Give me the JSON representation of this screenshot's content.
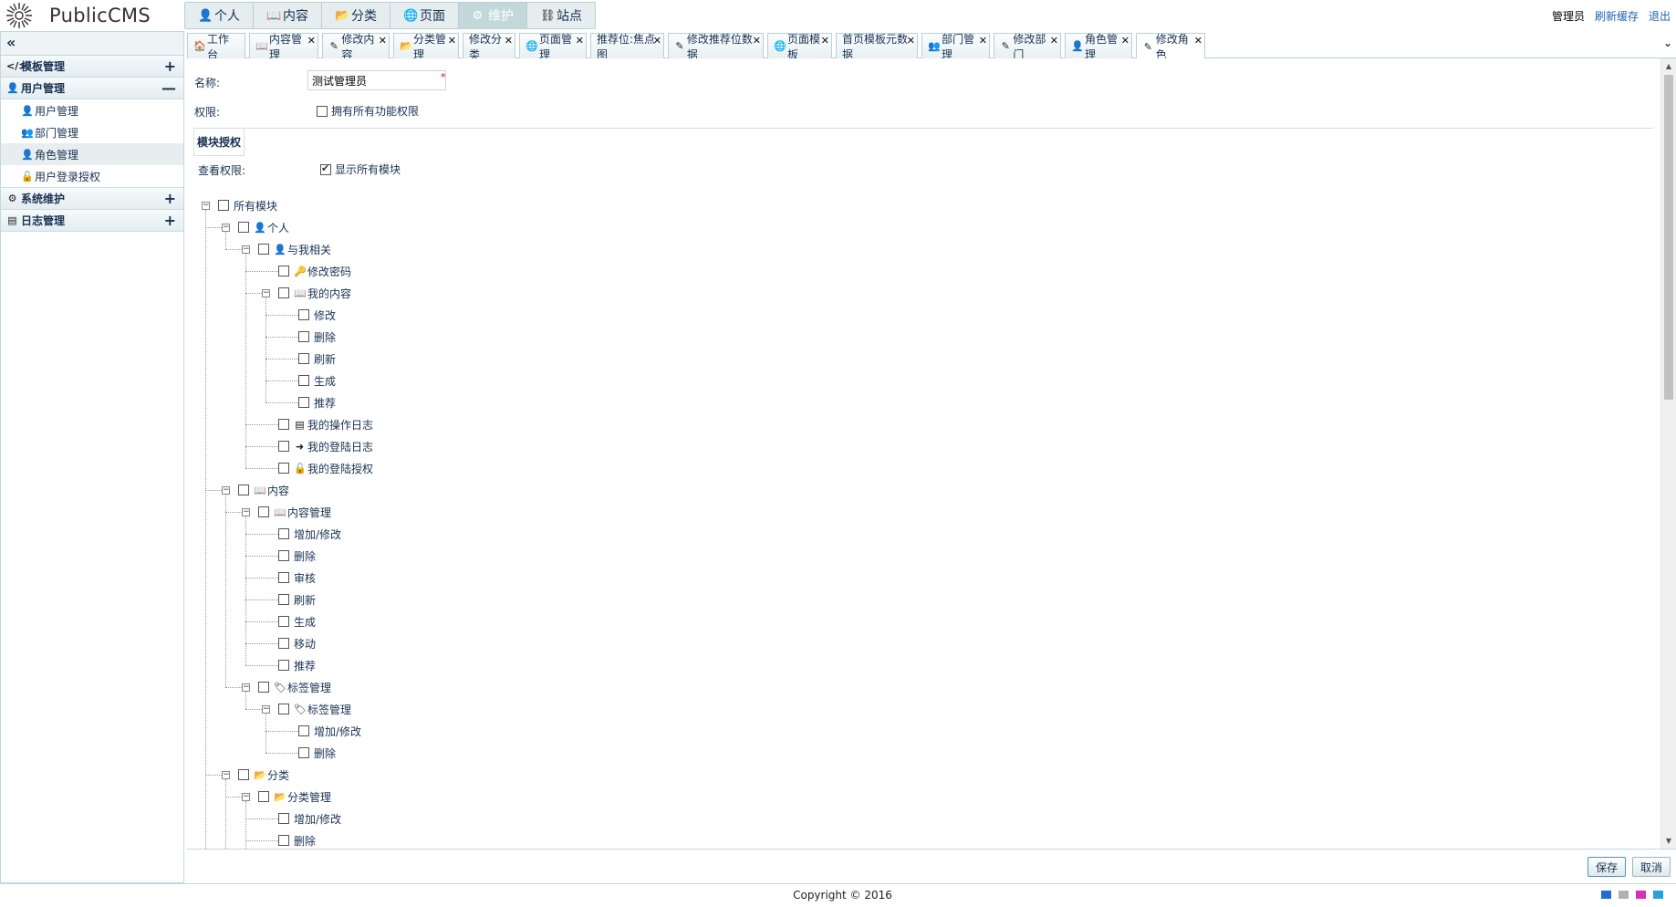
{
  "app": {
    "name": "PublicCMS"
  },
  "colors": {
    "accent": "#1e64b4",
    "nav_active": "#c2d9dc",
    "border": "#b8d0d6",
    "required": "#ee0000"
  },
  "topnav": [
    {
      "label": "个人",
      "icon": "user-icon",
      "glyph": "👤"
    },
    {
      "label": "内容",
      "icon": "book-icon",
      "glyph": "📖"
    },
    {
      "label": "分类",
      "icon": "folder-open-icon",
      "glyph": "📂"
    },
    {
      "label": "页面",
      "icon": "globe-icon",
      "glyph": "🌐"
    },
    {
      "label": "维护",
      "icon": "gear-icon",
      "glyph": "⚙",
      "active": true
    },
    {
      "label": "站点",
      "icon": "sitemap-icon",
      "glyph": "⛓"
    }
  ],
  "userbar": {
    "user": "管理员",
    "refresh_cache": "刷新缓存",
    "logout": "退出"
  },
  "sidebar": {
    "toggle": "«",
    "groups": [
      {
        "label": "模板管理",
        "icon": "code-icon",
        "glyph": "</>",
        "expanded": false
      },
      {
        "label": "用户管理",
        "icon": "user-icon",
        "glyph": "👤",
        "expanded": true,
        "items": [
          {
            "label": "用户管理",
            "icon": "user-icon",
            "glyph": "👤"
          },
          {
            "label": "部门管理",
            "icon": "users-icon",
            "glyph": "👥"
          },
          {
            "label": "角色管理",
            "icon": "user-secret-icon",
            "glyph": "👤",
            "active": true
          },
          {
            "label": "用户登录授权",
            "icon": "unlock-icon",
            "glyph": "🔓"
          }
        ]
      },
      {
        "label": "系统维护",
        "icon": "cogs-icon",
        "glyph": "⚙",
        "expanded": false
      },
      {
        "label": "日志管理",
        "icon": "list-alt-icon",
        "glyph": "▤",
        "expanded": false
      }
    ]
  },
  "tabs": [
    {
      "label": "工作台",
      "glyph": "🏠",
      "icon": "home-icon"
    },
    {
      "label": "内容管理",
      "glyph": "📖",
      "icon": "book-icon"
    },
    {
      "label": "修改内容",
      "glyph": "✎",
      "icon": "edit-icon"
    },
    {
      "label": "分类管理",
      "glyph": "📂",
      "icon": "folder-open-icon"
    },
    {
      "label": "修改分类",
      "glyph": "",
      "icon": ""
    },
    {
      "label": "页面管理",
      "glyph": "🌐",
      "icon": "globe-icon"
    },
    {
      "label": "推荐位:焦点图",
      "glyph": "",
      "icon": ""
    },
    {
      "label": "修改推荐位数据",
      "glyph": "✎",
      "icon": "edit-icon"
    },
    {
      "label": "页面模板",
      "glyph": "🌐",
      "icon": "globe-icon"
    },
    {
      "label": "首页模板元数据",
      "glyph": "",
      "icon": ""
    },
    {
      "label": "部门管理",
      "glyph": "👥",
      "icon": "users-icon"
    },
    {
      "label": "修改部门",
      "glyph": "✎",
      "icon": "edit-icon"
    },
    {
      "label": "角色管理",
      "glyph": "👤",
      "icon": "user-secret-icon"
    },
    {
      "label": "修改角色",
      "glyph": "✎",
      "icon": "edit-icon",
      "active": true
    }
  ],
  "form": {
    "name_label": "名称:",
    "name_value": "测试管理员",
    "required_mark": "*",
    "perm_label": "权限:",
    "all_perm_label": "拥有所有功能权限",
    "all_perm_checked": false,
    "module_legend": "模块授权",
    "view_label": "查看权限:",
    "show_all_label": "显示所有模块",
    "show_all_checked": true
  },
  "tree": [
    {
      "label": "所有模块",
      "level": 0,
      "toggle": true,
      "glyph": "",
      "icon": ""
    },
    {
      "label": "个人",
      "level": 1,
      "toggle": true,
      "glyph": "👤",
      "icon": "user-icon"
    },
    {
      "label": "与我相关",
      "level": 2,
      "toggle": true,
      "glyph": "👤",
      "icon": "user-icon"
    },
    {
      "label": "修改密码",
      "level": 3,
      "toggle": false,
      "glyph": "🔑",
      "icon": "key-icon"
    },
    {
      "label": "我的内容",
      "level": 3,
      "toggle": true,
      "glyph": "📖",
      "icon": "book-icon"
    },
    {
      "label": "修改",
      "level": 4,
      "toggle": false,
      "glyph": "",
      "icon": ""
    },
    {
      "label": "删除",
      "level": 4,
      "toggle": false,
      "glyph": "",
      "icon": ""
    },
    {
      "label": "刷新",
      "level": 4,
      "toggle": false,
      "glyph": "",
      "icon": ""
    },
    {
      "label": "生成",
      "level": 4,
      "toggle": false,
      "glyph": "",
      "icon": ""
    },
    {
      "label": "推荐",
      "level": 4,
      "toggle": false,
      "glyph": "",
      "icon": ""
    },
    {
      "label": "我的操作日志",
      "level": 3,
      "toggle": false,
      "glyph": "▤",
      "icon": "list-alt-icon"
    },
    {
      "label": "我的登陆日志",
      "level": 3,
      "toggle": false,
      "glyph": "➜",
      "icon": "sign-in-icon"
    },
    {
      "label": "我的登陆授权",
      "level": 3,
      "toggle": false,
      "glyph": "🔓",
      "icon": "unlock-icon"
    },
    {
      "label": "内容",
      "level": 1,
      "toggle": true,
      "glyph": "📖",
      "icon": "book-icon"
    },
    {
      "label": "内容管理",
      "level": 2,
      "toggle": true,
      "glyph": "📖",
      "icon": "book-icon"
    },
    {
      "label": "增加/修改",
      "level": 3,
      "toggle": false,
      "glyph": "",
      "icon": ""
    },
    {
      "label": "删除",
      "level": 3,
      "toggle": false,
      "glyph": "",
      "icon": ""
    },
    {
      "label": "审核",
      "level": 3,
      "toggle": false,
      "glyph": "",
      "icon": ""
    },
    {
      "label": "刷新",
      "level": 3,
      "toggle": false,
      "glyph": "",
      "icon": ""
    },
    {
      "label": "生成",
      "level": 3,
      "toggle": false,
      "glyph": "",
      "icon": ""
    },
    {
      "label": "移动",
      "level": 3,
      "toggle": false,
      "glyph": "",
      "icon": ""
    },
    {
      "label": "推荐",
      "level": 3,
      "toggle": false,
      "glyph": "",
      "icon": ""
    },
    {
      "label": "标签管理",
      "level": 2,
      "toggle": true,
      "glyph": "🏷",
      "icon": "tags-icon"
    },
    {
      "label": "标签管理",
      "level": 3,
      "toggle": true,
      "glyph": "🏷",
      "icon": "tag-icon"
    },
    {
      "label": "增加/修改",
      "level": 4,
      "toggle": false,
      "glyph": "",
      "icon": ""
    },
    {
      "label": "删除",
      "level": 4,
      "toggle": false,
      "glyph": "",
      "icon": ""
    },
    {
      "label": "分类",
      "level": 1,
      "toggle": true,
      "glyph": "📂",
      "icon": "folder-open-icon"
    },
    {
      "label": "分类管理",
      "level": 2,
      "toggle": true,
      "glyph": "📂",
      "icon": "folder-open-icon"
    },
    {
      "label": "增加/修改",
      "level": 3,
      "toggle": false,
      "glyph": "",
      "icon": ""
    },
    {
      "label": "删除",
      "level": 3,
      "toggle": false,
      "glyph": "",
      "icon": ""
    }
  ],
  "buttons": {
    "save": "保存",
    "cancel": "取消"
  },
  "footer": {
    "copyright": "Copyright © 2016",
    "themes": [
      "#1e6fd0",
      "#b0b0b0",
      "#d630b8",
      "#2aa0e0"
    ]
  }
}
